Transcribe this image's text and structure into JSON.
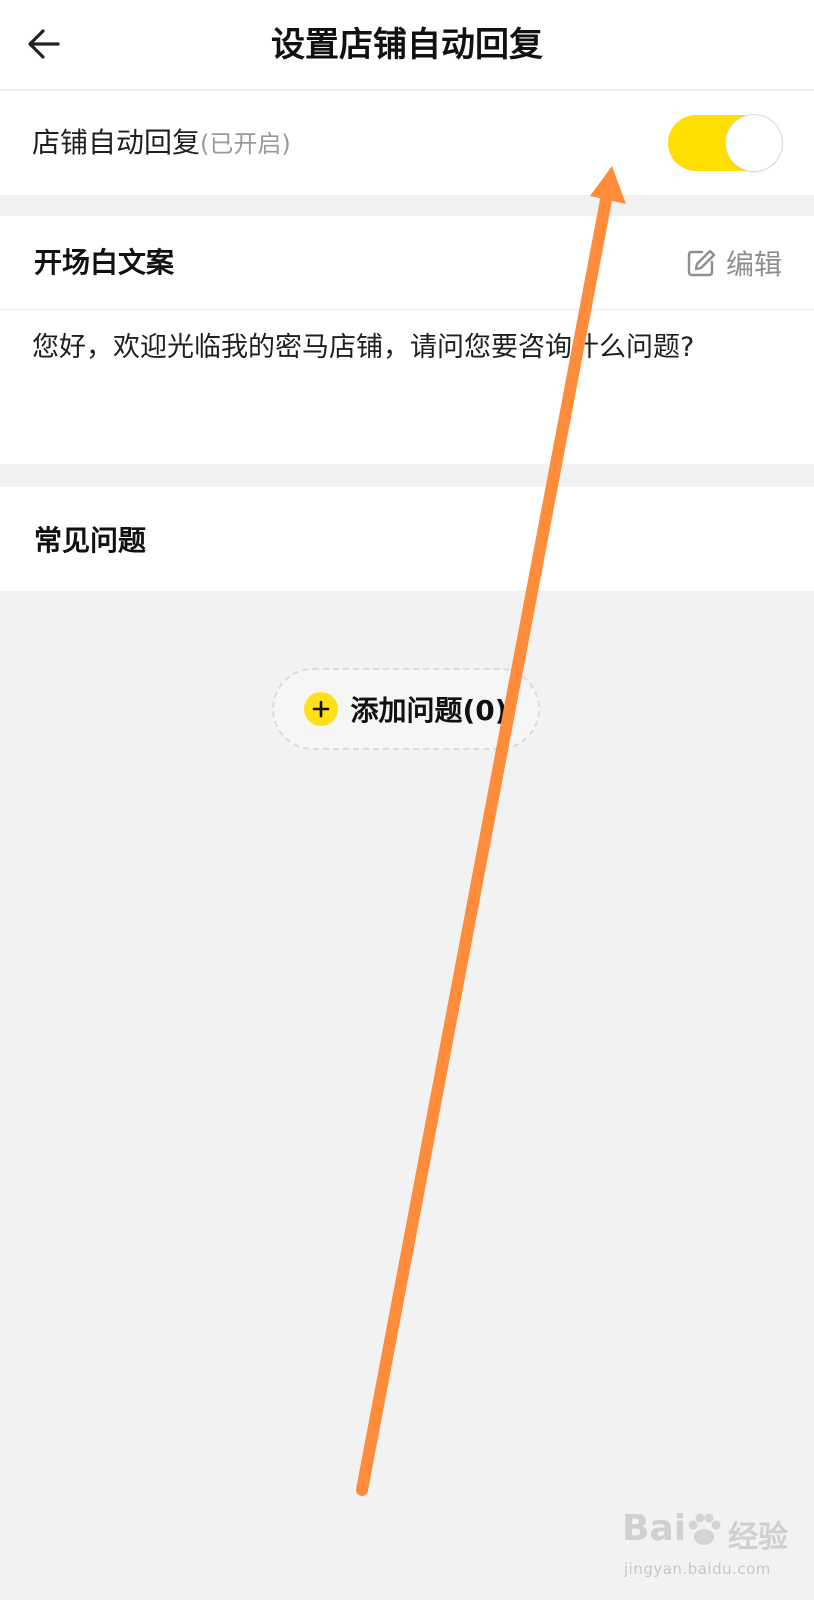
{
  "header": {
    "title": "设置店铺自动回复",
    "back_icon": "arrow-left-icon"
  },
  "auto_reply": {
    "label": "店铺自动回复",
    "status": "(已开启)",
    "toggle_on": true,
    "toggle_color": "#ffde00"
  },
  "greeting": {
    "title": "开场白文案",
    "edit_label": "编辑",
    "edit_icon": "edit-icon",
    "text": "您好，欢迎光临我的密马店铺，请问您要咨询什么问题?"
  },
  "faq": {
    "title": "常见问题",
    "add_label": "添加问题(0)",
    "add_icon": "plus-circle-icon"
  },
  "annotation": {
    "arrow_color": "#ff8c3a"
  },
  "watermark": {
    "brand": "Bai",
    "brand_suffix": "经验",
    "url": "jingyan.baidu.com"
  }
}
